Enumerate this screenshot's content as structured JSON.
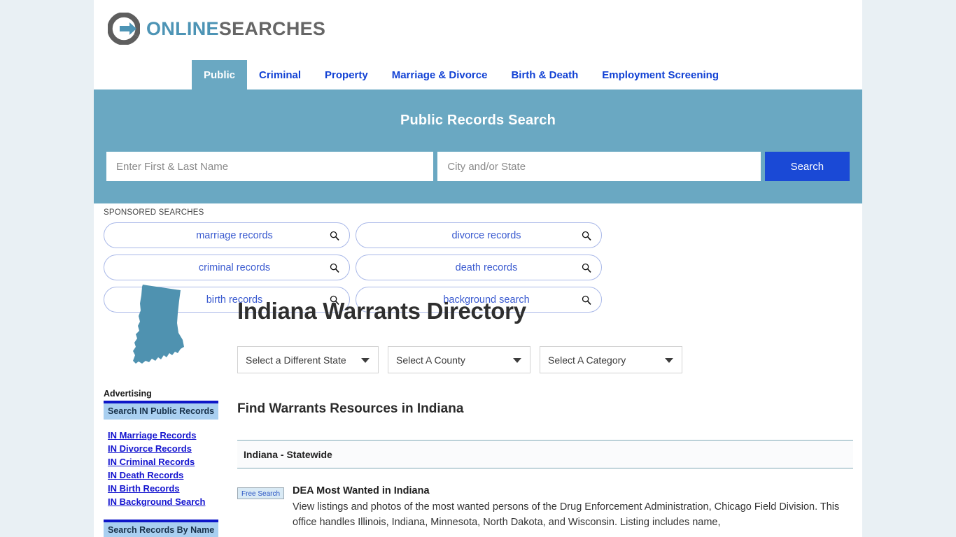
{
  "brand": {
    "logo_icon": "circle-arrow-icon",
    "name_part1": "ONLINE",
    "name_part2": "SEARCHES"
  },
  "nav": {
    "tabs": [
      {
        "label": "Public",
        "active": true
      },
      {
        "label": "Criminal",
        "active": false
      },
      {
        "label": "Property",
        "active": false
      },
      {
        "label": "Marriage & Divorce",
        "active": false
      },
      {
        "label": "Birth & Death",
        "active": false
      },
      {
        "label": "Employment Screening",
        "active": false
      }
    ]
  },
  "hero": {
    "title": "Public Records Search",
    "name_placeholder": "Enter First & Last Name",
    "name_value": "",
    "location_placeholder": "City and/or State",
    "location_value": "",
    "search_button": "Search",
    "background_color": "#6aa8c2",
    "button_color": "#1a49d6"
  },
  "sponsored": {
    "label": "SPONSORED SEARCHES",
    "items": [
      {
        "label": "marriage records",
        "icon": "search-icon"
      },
      {
        "label": "divorce records",
        "icon": "search-icon"
      },
      {
        "label": "criminal records",
        "icon": "search-icon"
      },
      {
        "label": "death records",
        "icon": "search-icon"
      },
      {
        "label": "birth records",
        "icon": "search-icon"
      },
      {
        "label": "background search",
        "icon": "search-icon"
      }
    ]
  },
  "sidebar": {
    "state_map_icon": "indiana-state-map-icon",
    "state_map_color": "#4f92b0",
    "advertising_label": "Advertising",
    "panel1_heading": "Search IN Public Records",
    "links": [
      "IN Marriage Records",
      "IN Divorce Records",
      "IN Criminal Records",
      "IN Death Records",
      "IN Birth Records",
      "IN Background Search"
    ],
    "panel2_heading": "Search Records By Name"
  },
  "main": {
    "page_title": "Indiana Warrants Directory",
    "filters": [
      {
        "label": "Select a Different State",
        "icon": "chevron-down-icon"
      },
      {
        "label": "Select A County",
        "icon": "chevron-down-icon"
      },
      {
        "label": "Select A Category",
        "icon": "chevron-down-icon"
      }
    ],
    "section_title": "Find Warrants Resources in Indiana",
    "group_heading": "Indiana - Statewide",
    "listings": [
      {
        "badge": "Free Search",
        "title": "DEA Most Wanted in Indiana",
        "description": "View listings and photos of the most wanted persons of the Drug Enforcement Administration, Chicago Field Division. This office handles Illinois, Indiana, Minnesota, North Dakota, and Wisconsin. Listing includes name,"
      }
    ]
  }
}
